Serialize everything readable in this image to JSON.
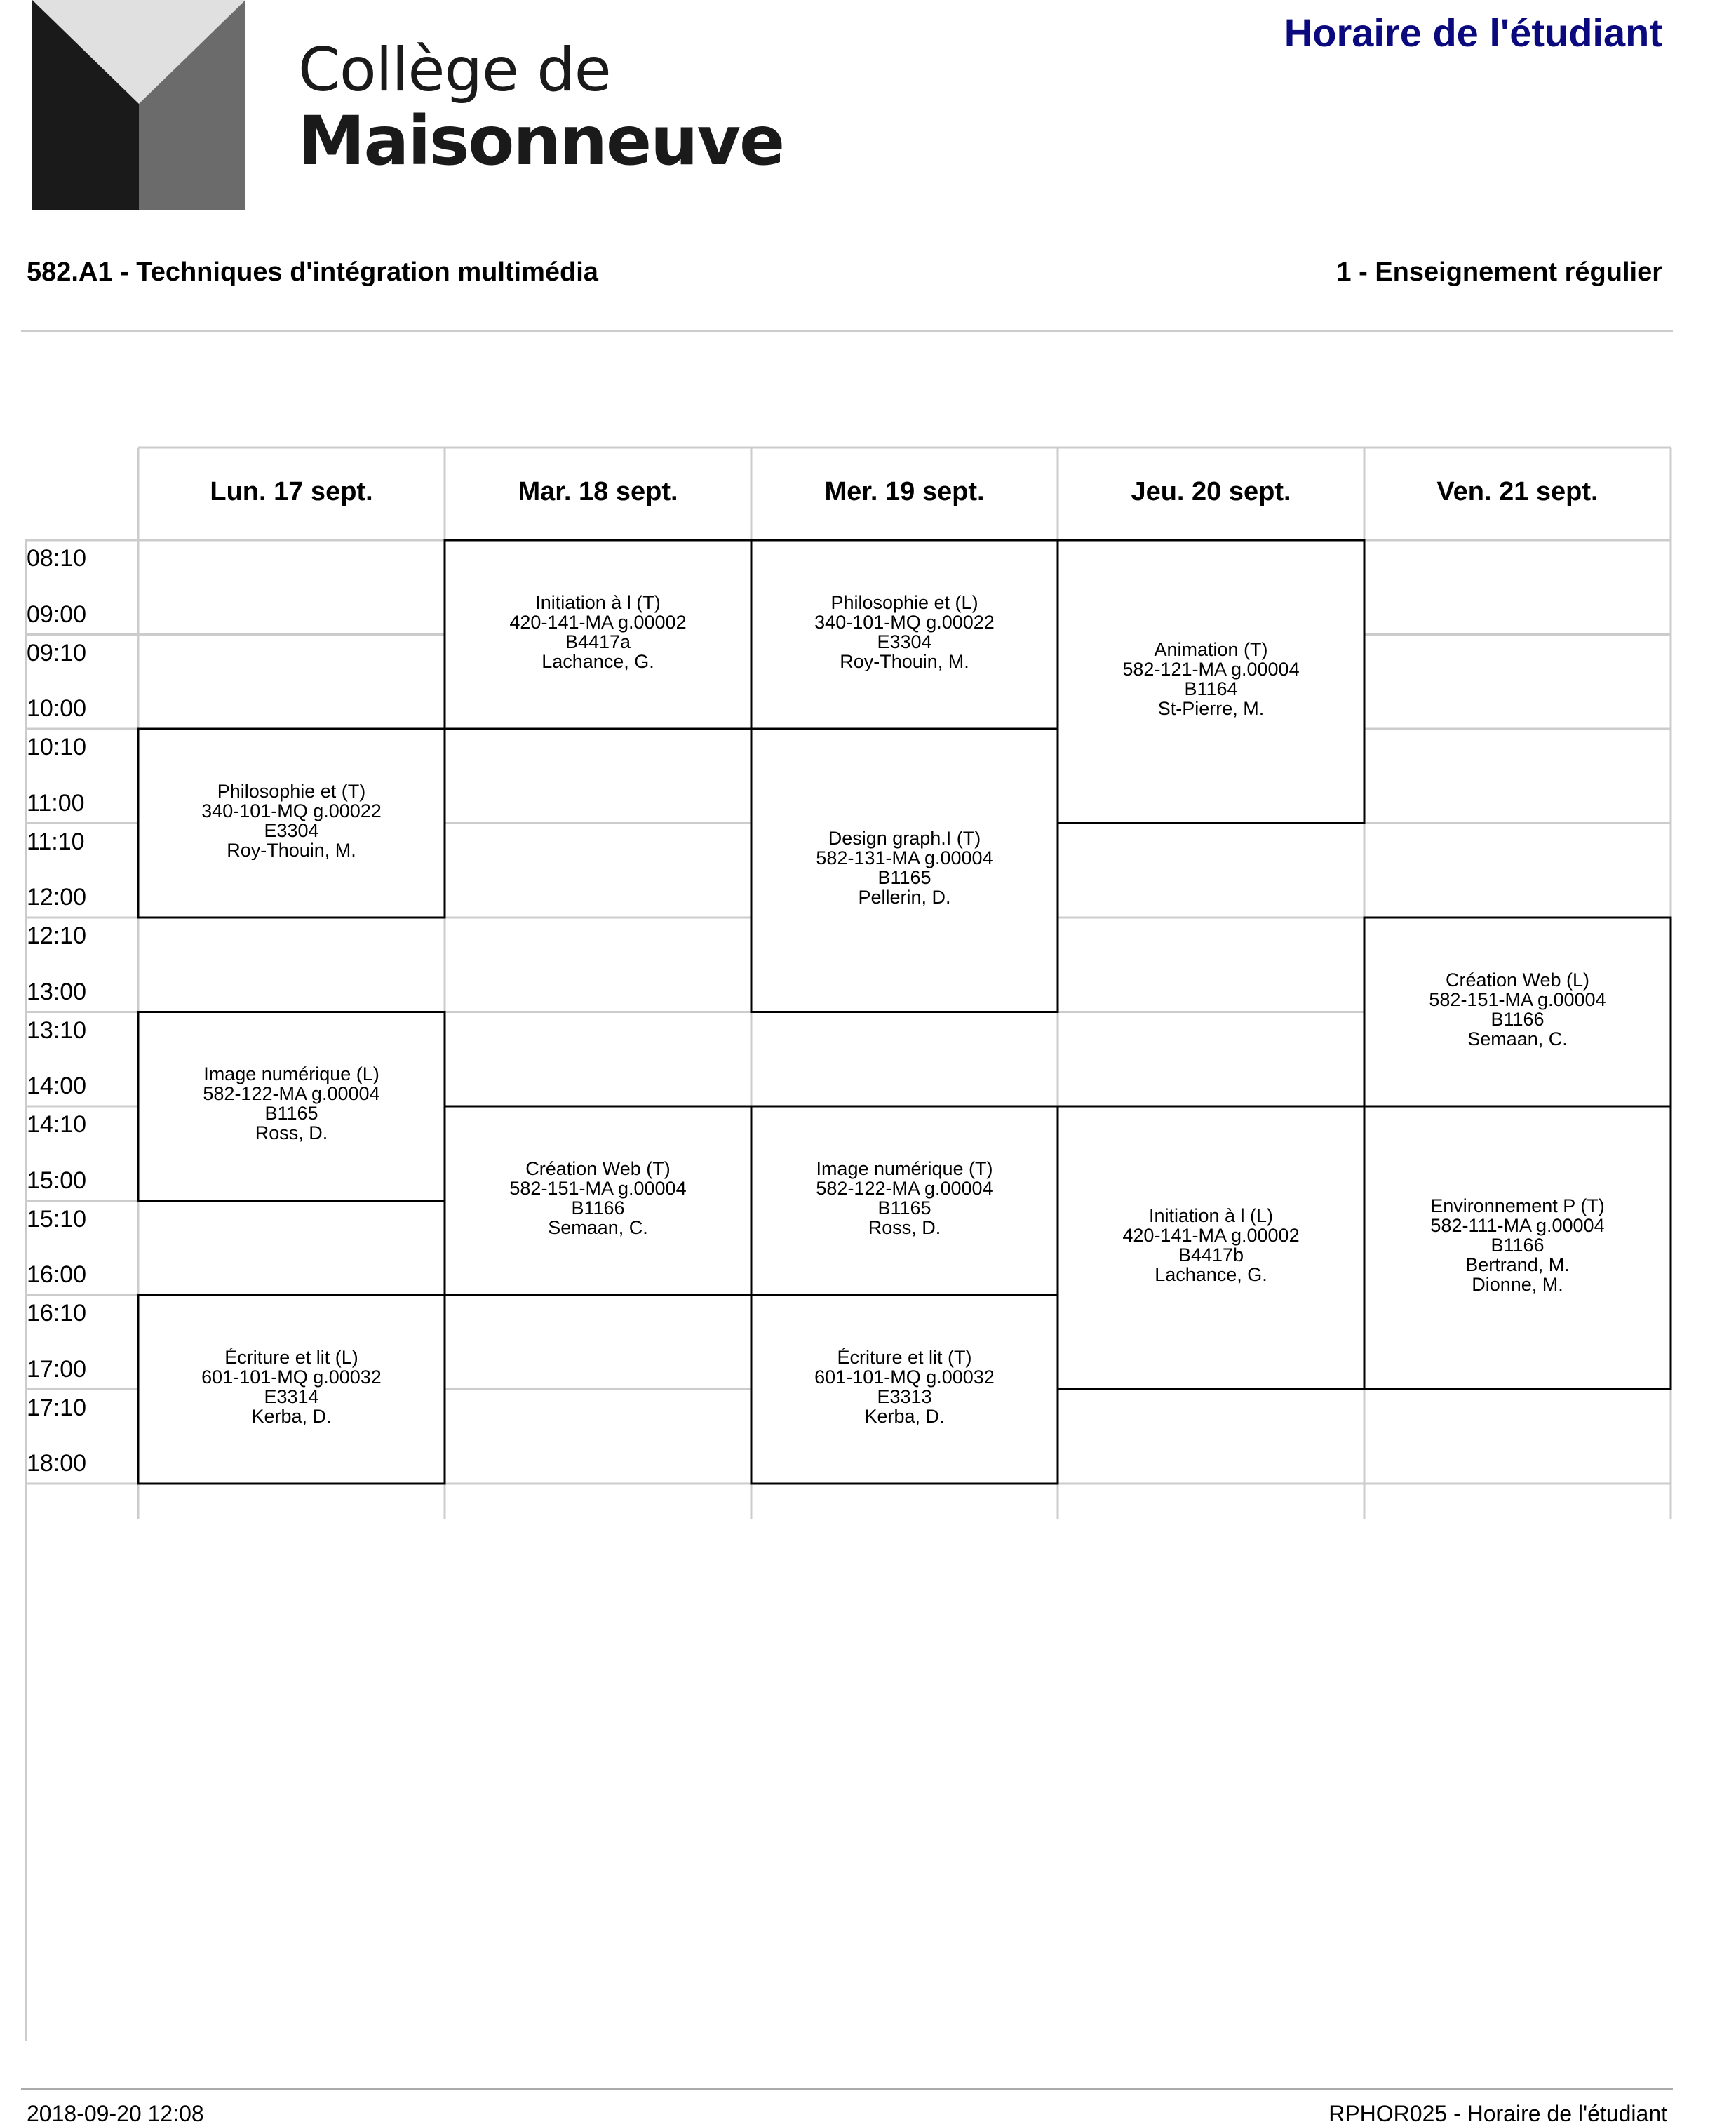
{
  "header": {
    "logo_line1": "Collège de",
    "logo_line2": "Maisonneuve",
    "title": "Horaire de l'étudiant"
  },
  "program": "582.A1 - Techniques d'intégration multimédia",
  "session": "1 - Enseignement régulier",
  "days": [
    "Lun. 17 sept.",
    "Mar. 18 sept.",
    "Mer. 19 sept.",
    "Jeu. 20 sept.",
    "Ven. 21 sept."
  ],
  "time_labels": [
    "08:10",
    "09:00",
    "09:10",
    "10:00",
    "10:10",
    "11:00",
    "11:10",
    "12:00",
    "12:10",
    "13:00",
    "13:10",
    "14:00",
    "14:10",
    "15:00",
    "15:10",
    "16:00",
    "16:10",
    "17:00",
    "17:10",
    "18:00"
  ],
  "courses": [
    {
      "day": 0,
      "start": 2,
      "end": 4,
      "lines": [
        "Philosophie et (T)",
        "340-101-MQ g.00022",
        "E3304",
        "Roy-Thouin, M."
      ]
    },
    {
      "day": 0,
      "start": 5,
      "end": 7,
      "lines": [
        "Image numérique (L)",
        "582-122-MA g.00004",
        "B1165",
        "Ross, D."
      ]
    },
    {
      "day": 0,
      "start": 8,
      "end": 10,
      "lines": [
        "Écriture et lit (L)",
        "601-101-MQ g.00032",
        "E3314",
        "Kerba, D."
      ]
    },
    {
      "day": 1,
      "start": 0,
      "end": 2,
      "lines": [
        "Initiation à  l (T)",
        "420-141-MA g.00002",
        "B4417a",
        "Lachance, G."
      ]
    },
    {
      "day": 1,
      "start": 6,
      "end": 8,
      "lines": [
        "Création Web (T)",
        "582-151-MA g.00004",
        "B1166",
        "Semaan, C."
      ]
    },
    {
      "day": 2,
      "start": 0,
      "end": 2,
      "lines": [
        "Philosophie et (L)",
        "340-101-MQ g.00022",
        "E3304",
        "Roy-Thouin, M."
      ]
    },
    {
      "day": 2,
      "start": 2,
      "end": 5,
      "lines": [
        "Design graph.I (T)",
        "582-131-MA g.00004",
        "B1165",
        "Pellerin, D."
      ]
    },
    {
      "day": 2,
      "start": 6,
      "end": 8,
      "lines": [
        "Image numérique (T)",
        "582-122-MA g.00004",
        "B1165",
        "Ross, D."
      ]
    },
    {
      "day": 2,
      "start": 8,
      "end": 10,
      "lines": [
        "Écriture et lit (T)",
        "601-101-MQ g.00032",
        "E3313",
        "Kerba, D."
      ]
    },
    {
      "day": 3,
      "start": 0,
      "end": 3,
      "lines": [
        "Animation (T)",
        "582-121-MA g.00004",
        "B1164",
        "St-Pierre, M."
      ]
    },
    {
      "day": 3,
      "start": 6,
      "end": 9,
      "lines": [
        "Initiation à  l (L)",
        "420-141-MA g.00002",
        "B4417b",
        "Lachance, G."
      ]
    },
    {
      "day": 4,
      "start": 4,
      "end": 6,
      "lines": [
        "Création Web (L)",
        "582-151-MA g.00004",
        "B1166",
        "Semaan, C."
      ]
    },
    {
      "day": 4,
      "start": 6,
      "end": 9,
      "lines": [
        "Environnement P (T)",
        "582-111-MA g.00004",
        "B1166",
        "Bertrand, M.",
        "Dionne, M."
      ]
    }
  ],
  "footer": {
    "timestamp": "2018-09-20 12:08",
    "report": "RPHOR025 - Horaire de l'étudiant"
  }
}
